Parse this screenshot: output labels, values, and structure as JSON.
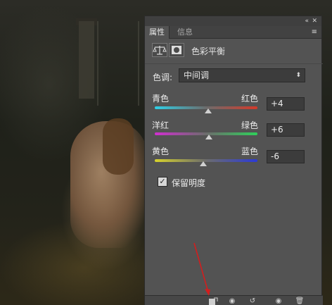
{
  "panel": {
    "tabs": [
      {
        "label": "属性",
        "active": true
      },
      {
        "label": "信息",
        "active": false
      }
    ],
    "top_controls": {
      "collapse": "«",
      "close": "✕"
    },
    "menu_icon": "panel-menu-icon",
    "header_title": "色彩平衡",
    "tone": {
      "label": "色调:",
      "selected": "中间调"
    },
    "sliders": [
      {
        "left": "青色",
        "right": "红色",
        "value": "+4",
        "fraction": 0.52
      },
      {
        "left": "洋红",
        "right": "绿色",
        "value": "+6",
        "fraction": 0.53
      },
      {
        "left": "黄色",
        "right": "蓝色",
        "value": "-6",
        "fraction": 0.47
      }
    ],
    "preserve_luminosity": {
      "label": "保留明度",
      "checked": true
    },
    "bottom_icons": [
      "clip-to-layer-icon",
      "view-previous-icon",
      "reset-icon",
      "visibility-icon",
      "delete-icon"
    ]
  },
  "colors": {
    "panel_bg": "#535353",
    "annotation_arrow": "#d21e1e"
  }
}
